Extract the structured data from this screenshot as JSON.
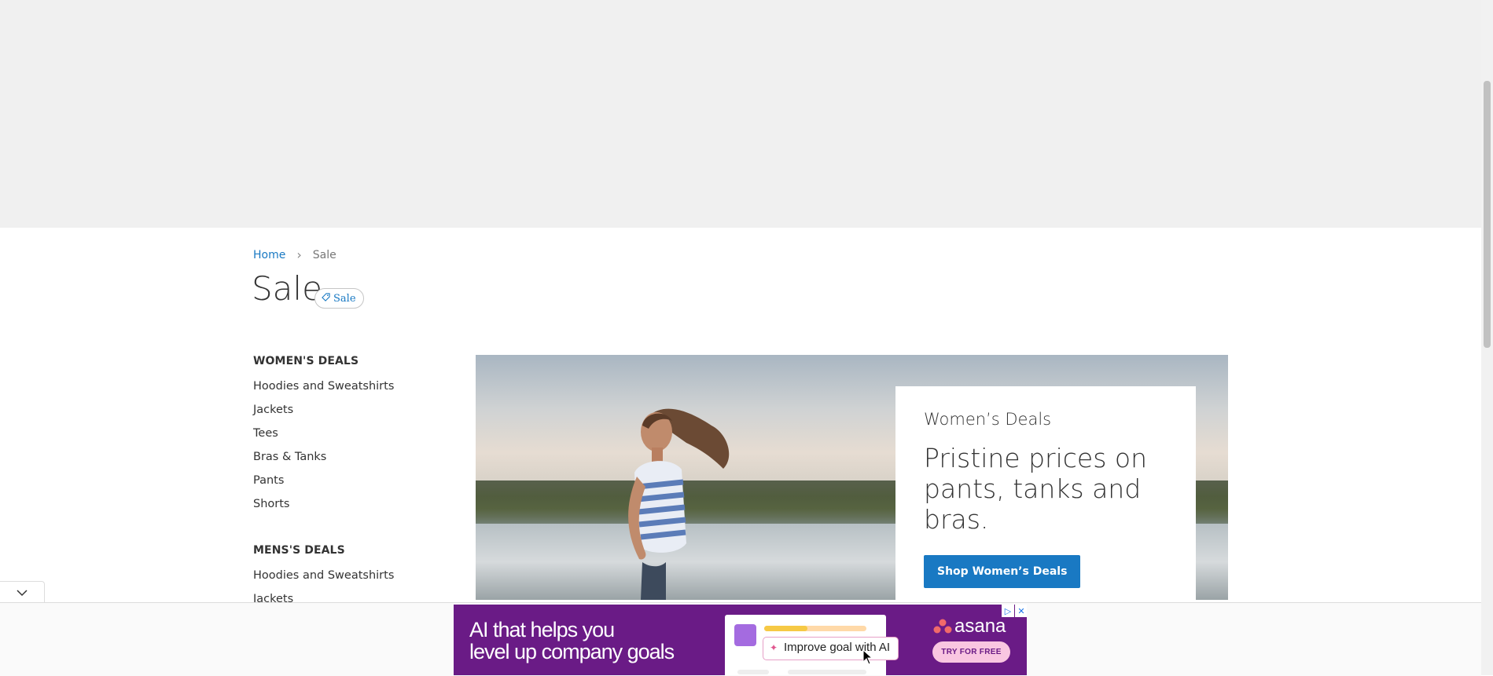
{
  "breadcrumb": {
    "home": "Home",
    "current": "Sale"
  },
  "page": {
    "title": "Sale",
    "badge": "Sale"
  },
  "sidebar": {
    "sections": [
      {
        "heading": "WOMEN'S DEALS",
        "items": [
          "Hoodies and Sweatshirts",
          "Jackets",
          "Tees",
          "Bras & Tanks",
          "Pants",
          "Shorts"
        ]
      },
      {
        "heading": "MENS'S DEALS",
        "items": [
          "Hoodies and Sweatshirts",
          "Jackets"
        ]
      }
    ]
  },
  "hero": {
    "subtitle": "Women’s Deals",
    "headline": "Pristine prices on pants, tanks and bras.",
    "button_label": "Shop Women’s Deals"
  },
  "ad": {
    "headline_line1": "AI that helps you",
    "headline_line2": "level up company goals",
    "chip_label": "Improve goal with AI",
    "brand": "asana",
    "cta": "TRY FOR FREE"
  },
  "colors": {
    "accent": "#1979c3",
    "ad_background": "#6a1b86",
    "top_band": "#f0f0f0"
  }
}
